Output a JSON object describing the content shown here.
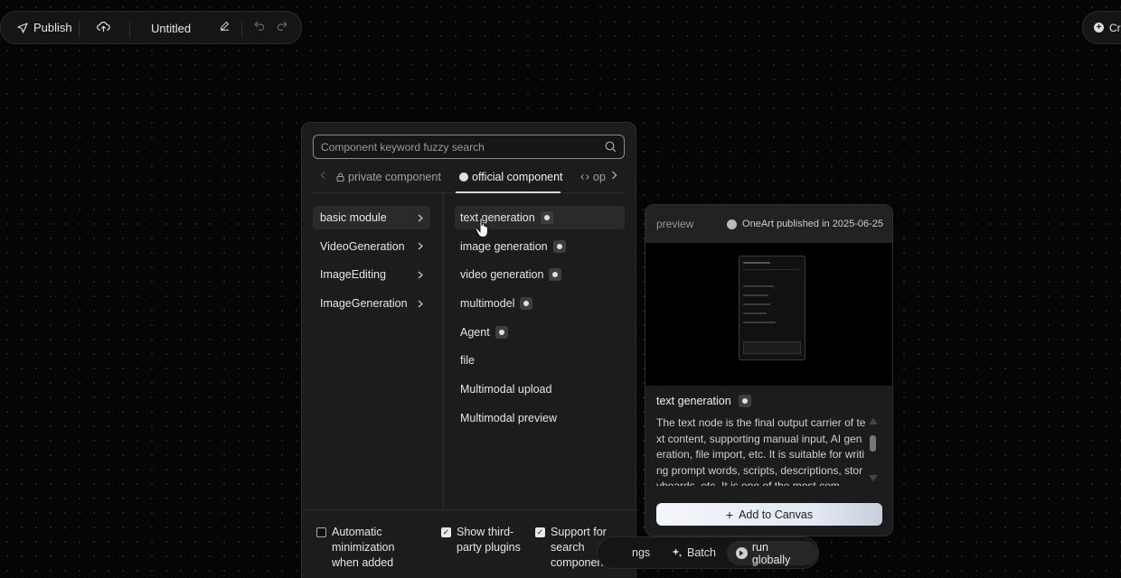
{
  "toolbar": {
    "publish_label": "Publish",
    "title": "Untitled"
  },
  "create_pill": {
    "label": "Cr"
  },
  "panel": {
    "search_placeholder": "Component keyword fuzzy search",
    "tabs": [
      {
        "label": "private component"
      },
      {
        "label": "official component"
      },
      {
        "label": "op"
      }
    ],
    "categories": [
      {
        "label": "basic module"
      },
      {
        "label": "VideoGeneration"
      },
      {
        "label": "ImageEditing"
      },
      {
        "label": "ImageGeneration"
      }
    ],
    "components": [
      {
        "label": "text generation"
      },
      {
        "label": "image generation"
      },
      {
        "label": "video generation"
      },
      {
        "label": "multimodel"
      },
      {
        "label": "Agent"
      },
      {
        "label": "file"
      },
      {
        "label": "Multimodal upload"
      },
      {
        "label": "Multimodal preview"
      }
    ],
    "options": [
      {
        "label": "Automatic minimization when added",
        "checked": false
      },
      {
        "label": "Show third-party plugins",
        "checked": true
      },
      {
        "label": "Support for search components",
        "checked": true
      }
    ]
  },
  "bottom_bar": {
    "settings_fragment": "ngs",
    "batch_label": "Batch",
    "run_label": "run globally"
  },
  "preview": {
    "label": "preview",
    "publisher": "OneArt published in 2025-06-25",
    "title": "text generation",
    "description": "The text node is the final output carrier of text content, supporting manual input, AI generation, file import, etc. It is suitable for writing prompt words, scripts, descriptions, storyboards, etc. It is one of the most com",
    "add_button": "Add to Canvas"
  },
  "colors": {
    "background": "#050505",
    "panel": "#1c1c1c",
    "accent_button_start": "#f4f6fb",
    "accent_button_end": "#c7cfdd"
  }
}
